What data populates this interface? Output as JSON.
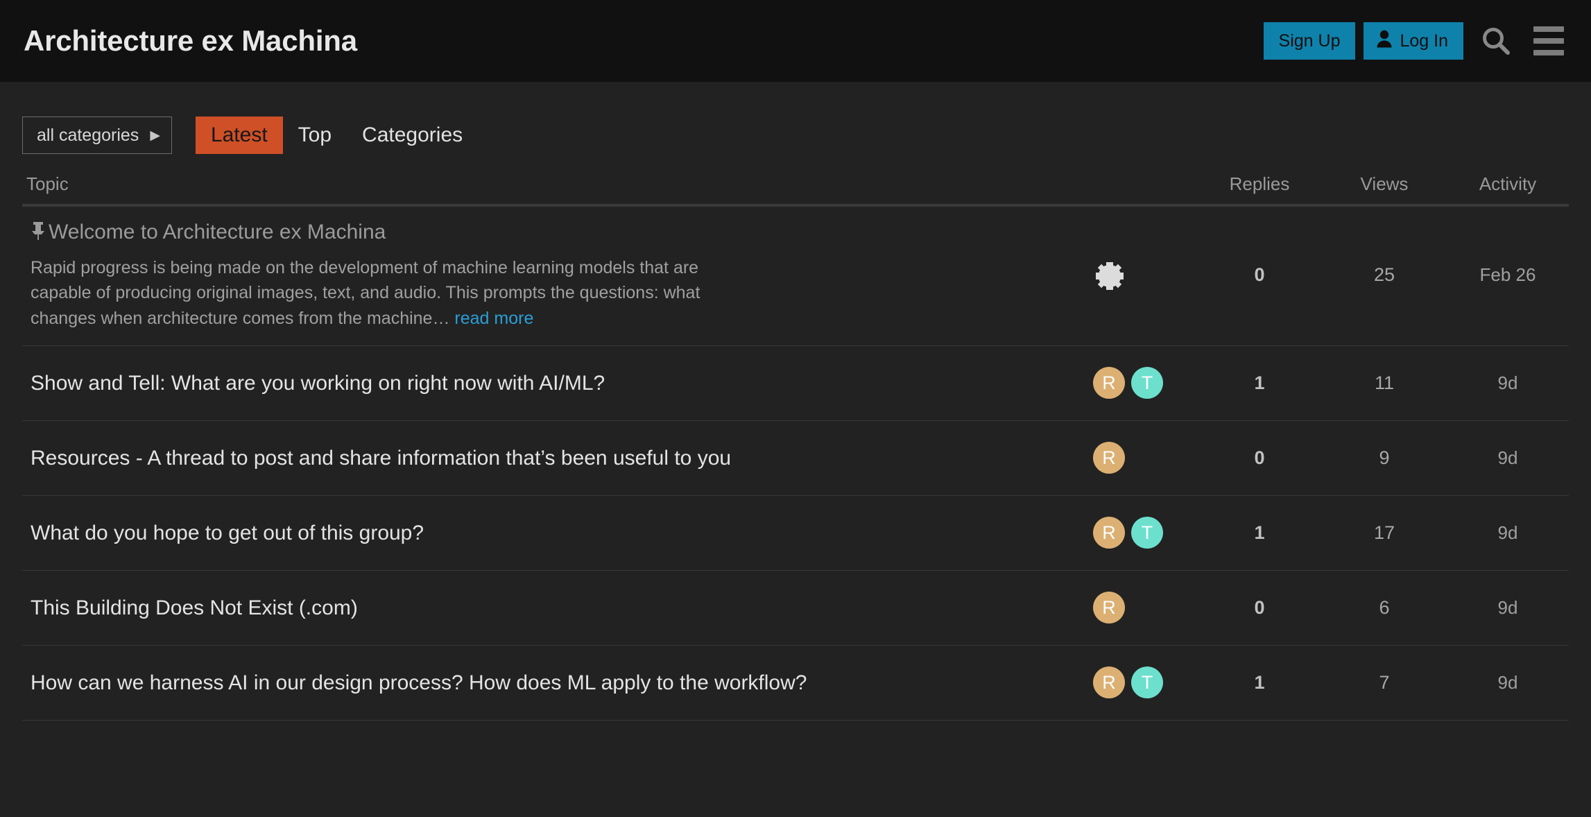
{
  "header": {
    "title": "Architecture ex Machina",
    "sign_up_label": "Sign Up",
    "log_in_label": "Log In",
    "search_icon": "search-icon",
    "menu_icon": "hamburger-menu-icon"
  },
  "nav": {
    "category_selector": "all categories",
    "category_caret": "▶",
    "links": [
      {
        "label": "Latest",
        "active": true
      },
      {
        "label": "Top",
        "active": false
      },
      {
        "label": "Categories",
        "active": false
      }
    ]
  },
  "table": {
    "headers": {
      "topic": "Topic",
      "replies": "Replies",
      "views": "Views",
      "activity": "Activity"
    },
    "rows": [
      {
        "pinned": true,
        "pin_icon": "📌",
        "title": "Welcome to Architecture ex Machina",
        "excerpt": "Rapid progress is being made on the development of machine learning models that are capable of producing original images, text, and audio. This prompts the questions: what changes when architecture comes from the machine… ",
        "read_more": "read more",
        "posters_icon": "gear-icon",
        "posters": [],
        "replies": "0",
        "views": "25",
        "activity": "Feb 26"
      },
      {
        "pinned": false,
        "title": "Show and Tell: What are you working on right now with AI/ML?",
        "posters": [
          {
            "initial": "R",
            "color": "#dcb072"
          },
          {
            "initial": "T",
            "color": "#6ce0cd"
          }
        ],
        "replies": "1",
        "views": "11",
        "activity": "9d"
      },
      {
        "pinned": false,
        "title": "Resources - A thread to post and share information that’s been useful to you",
        "posters": [
          {
            "initial": "R",
            "color": "#dcb072"
          }
        ],
        "replies": "0",
        "views": "9",
        "activity": "9d"
      },
      {
        "pinned": false,
        "title": "What do you hope to get out of this group?",
        "posters": [
          {
            "initial": "R",
            "color": "#dcb072"
          },
          {
            "initial": "T",
            "color": "#6ce0cd"
          }
        ],
        "replies": "1",
        "views": "17",
        "activity": "9d"
      },
      {
        "pinned": false,
        "title": "This Building Does Not Exist (.com)",
        "posters": [
          {
            "initial": "R",
            "color": "#dcb072"
          }
        ],
        "replies": "0",
        "views": "6",
        "activity": "9d"
      },
      {
        "pinned": false,
        "title": "How can we harness AI in our design process? How does ML apply to the workflow?",
        "posters": [
          {
            "initial": "R",
            "color": "#dcb072"
          },
          {
            "initial": "T",
            "color": "#6ce0cd"
          }
        ],
        "replies": "1",
        "views": "7",
        "activity": "9d"
      }
    ]
  },
  "colors": {
    "header_bg": "#111111",
    "page_bg": "#222222",
    "accent_blue": "#0f82ab",
    "accent_orange": "#cf5027",
    "link_blue": "#2a9fd6"
  }
}
